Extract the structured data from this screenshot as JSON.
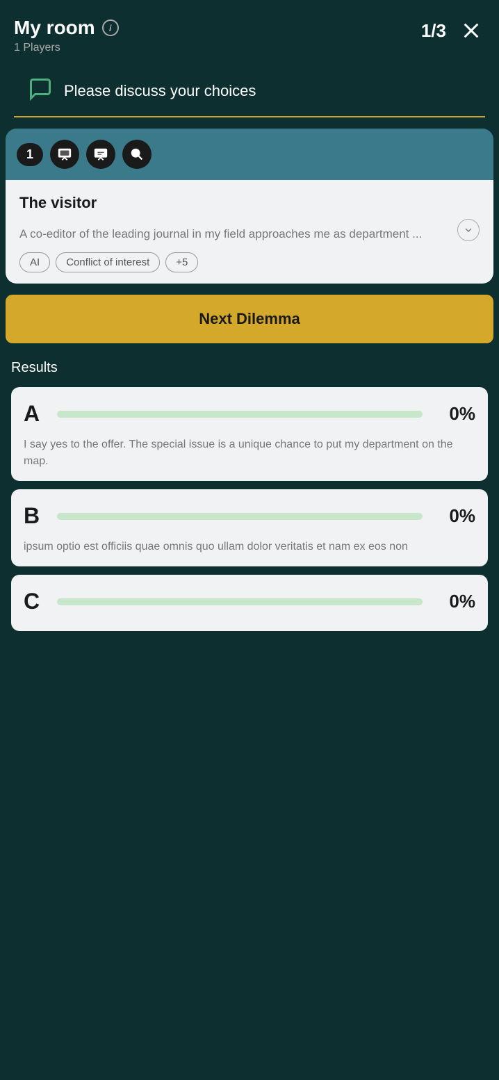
{
  "header": {
    "title": "My room",
    "players_label": "1 Players",
    "counter": "1/3",
    "close_label": "×"
  },
  "discussion": {
    "text": "Please discuss your choices"
  },
  "card": {
    "badge": "1",
    "title": "The visitor",
    "description": "A co-editor of the leading journal in my field approaches me as department ...",
    "tags": [
      "AI",
      "Conflict of interest",
      "+5"
    ]
  },
  "next_button": {
    "label": "Next Dilemma"
  },
  "results": {
    "title": "Results",
    "items": [
      {
        "letter": "A",
        "percent": "0%",
        "bar_width": 0,
        "description": "I say yes to the offer. The special issue is a unique chance to put my department on the map."
      },
      {
        "letter": "B",
        "percent": "0%",
        "bar_width": 0,
        "description": "ipsum optio est officiis quae omnis quo ullam dolor veritatis et nam ex eos non"
      },
      {
        "letter": "C",
        "percent": "0%",
        "bar_width": 0,
        "description": ""
      }
    ]
  }
}
